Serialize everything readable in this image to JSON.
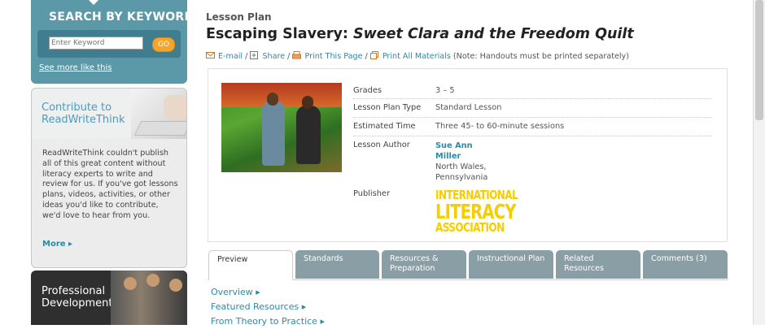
{
  "sidebar": {
    "search": {
      "title": "SEARCH BY KEYWORD",
      "placeholder": "Enter Keyword",
      "go_label": "GO",
      "more_link": "See more like this"
    },
    "contribute": {
      "title": "Contribute to ReadWriteThink",
      "body": "ReadWriteThink couldn't publish all of this great content without literacy experts to write and review for us. If you've got lessons plans, videos, activities, or other ideas you'd like to contribute, we'd love to hear from you.",
      "more_label": "More ▸"
    },
    "professional": {
      "title": "Professional Development"
    }
  },
  "main": {
    "kicker": "Lesson Plan",
    "title_plain": "Escaping Slavery: ",
    "title_italic": "Sweet Clara and the Freedom Quilt",
    "actions": {
      "email": "E-mail",
      "share": "Share",
      "print_page": "Print This Page",
      "print_all": "Print All Materials",
      "note": "(Note: Handouts must be printed separately)"
    },
    "details": {
      "grades_label": "Grades",
      "grades_value": "3 – 5",
      "type_label": "Lesson Plan Type",
      "type_value": "Standard Lesson",
      "time_label": "Estimated Time",
      "time_value": "Three 45- to 60-minute sessions",
      "author_label": "Lesson Author",
      "author_first": "Sue Ann",
      "author_last": "Miller",
      "author_city": "North Wales,",
      "author_state": "Pennsylvania",
      "publisher_label": "Publisher",
      "publisher_line1": "INTERNATIONAL",
      "publisher_line2": "LITERACY",
      "publisher_line3": "ASSOCIATION"
    },
    "tabs": [
      {
        "label": "Preview"
      },
      {
        "label": "Standards"
      },
      {
        "label": "Resources & Preparation"
      },
      {
        "label": "Instructional Plan"
      },
      {
        "label": "Related Resources"
      },
      {
        "label": "Comments (3)"
      }
    ],
    "sublinks": [
      "Overview ▸",
      "Featured Resources ▸",
      "From Theory to Practice ▸"
    ]
  },
  "colors": {
    "accent_teal": "#5b98a8",
    "link": "#2a8aa8",
    "go_button": "#f2a72c",
    "ila_yellow": "#f5cd00",
    "tab_gray": "#8a9ea6"
  },
  "icons": [
    "email-icon",
    "share-icon",
    "print-icon",
    "print-all-icon",
    "chevron-right-icon"
  ]
}
